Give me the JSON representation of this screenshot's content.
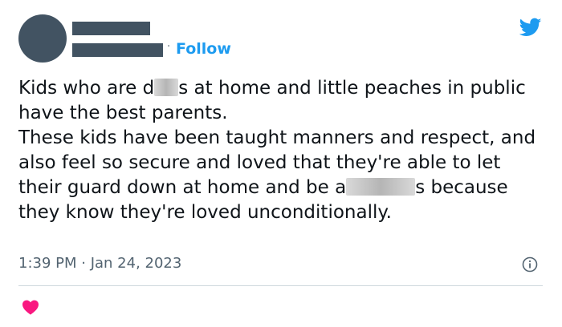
{
  "header": {
    "separator": "·",
    "follow_label": "Follow",
    "brand_icon": "twitter-bird-icon",
    "brand_color": "#1d9bf0"
  },
  "tweet": {
    "para1_pre": "Kids who are d",
    "para1_post": "s at home and little peaches in public have the best parents.",
    "para2_pre": "These kids have been taught manners and respect, and also feel so secure and loved that they're able to let their guard down at home and be a",
    "para2_post": "s because they know they're loved unconditionally."
  },
  "meta": {
    "timestamp": "1:39 PM · Jan 24, 2023",
    "info_icon": "info-icon"
  },
  "actions": {
    "like_icon": "heart-icon",
    "like_color": "#f91880"
  }
}
